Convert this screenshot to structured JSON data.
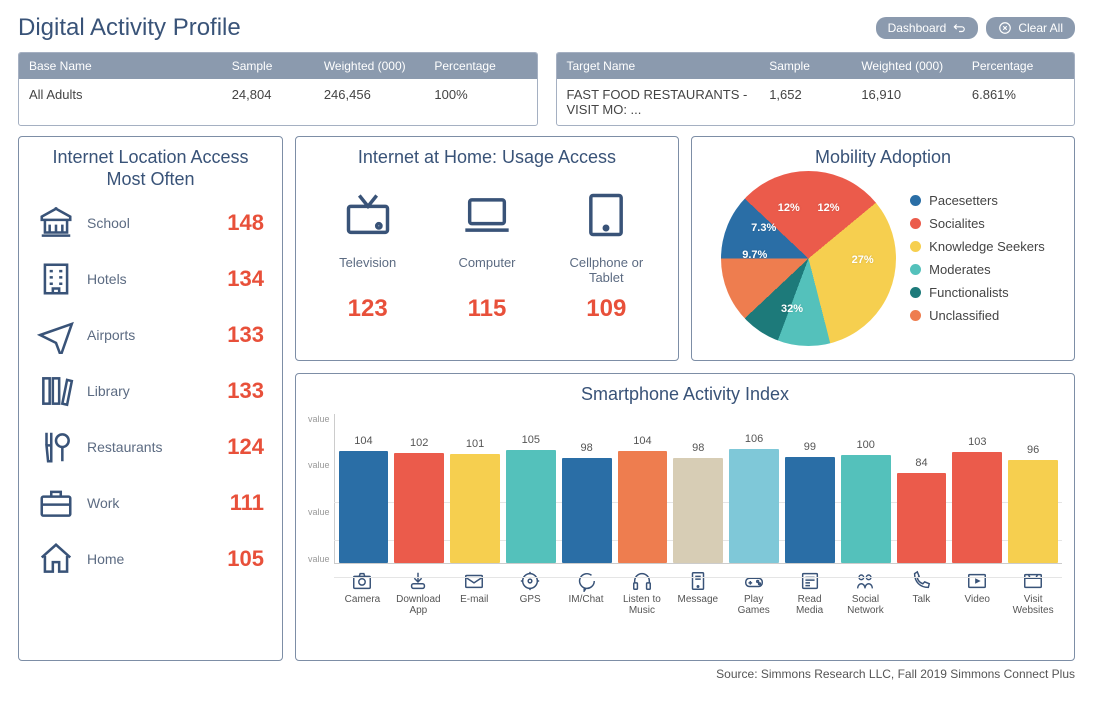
{
  "title": "Digital Activity Profile",
  "header_buttons": {
    "dashboard": "Dashboard",
    "clear_all": "Clear All"
  },
  "base_table": {
    "headers": {
      "c1": "Base Name",
      "c2": "Sample",
      "c3": "Weighted (000)",
      "c4": "Percentage"
    },
    "row": {
      "name": "All Adults",
      "sample": "24,804",
      "weighted": "246,456",
      "percentage": "100%"
    }
  },
  "target_table": {
    "headers": {
      "c1": "Target Name",
      "c2": "Sample",
      "c3": "Weighted (000)",
      "c4": "Percentage"
    },
    "row": {
      "name": "FAST FOOD RESTAURANTS - VISIT MO: ...",
      "sample": "1,652",
      "weighted": "16,910",
      "percentage": "6.861%"
    }
  },
  "location_panel": {
    "title": "Internet Location Access Most Often",
    "items": [
      {
        "label": "School",
        "value": "148",
        "icon": "school-icon"
      },
      {
        "label": "Hotels",
        "value": "134",
        "icon": "building-icon"
      },
      {
        "label": "Airports",
        "value": "133",
        "icon": "airplane-icon"
      },
      {
        "label": "Library",
        "value": "133",
        "icon": "books-icon"
      },
      {
        "label": "Restaurants",
        "value": "124",
        "icon": "utensils-icon"
      },
      {
        "label": "Work",
        "value": "111",
        "icon": "briefcase-icon"
      },
      {
        "label": "Home",
        "value": "105",
        "icon": "home-icon"
      }
    ]
  },
  "home_usage": {
    "title": "Internet at Home: Usage Access",
    "items": [
      {
        "label": "Television",
        "value": "123",
        "icon": "television-icon"
      },
      {
        "label": "Computer",
        "value": "115",
        "icon": "laptop-icon"
      },
      {
        "label": "Cellphone or Tablet",
        "value": "109",
        "icon": "tablet-icon"
      }
    ]
  },
  "mobility": {
    "title": "Mobility Adoption",
    "legend": [
      {
        "label": "Pacesetters",
        "color": "#2a6ea6"
      },
      {
        "label": "Socialites",
        "color": "#eb5b4b"
      },
      {
        "label": "Knowledge Seekers",
        "color": "#f6cf4f"
      },
      {
        "label": "Moderates",
        "color": "#54c1bb"
      },
      {
        "label": "Functionalists",
        "color": "#1d7a7a"
      },
      {
        "label": "Unclassified",
        "color": "#ee7d4f"
      }
    ]
  },
  "activity_index": {
    "title": "Smartphone Activity Index",
    "y_tick": "value",
    "bars": [
      {
        "label": "Camera",
        "value": 104,
        "color": "#2a6ea6",
        "icon": "camera-icon"
      },
      {
        "label": "Download App",
        "value": 102,
        "color": "#eb5b4b",
        "icon": "download-app-icon"
      },
      {
        "label": "E-mail",
        "value": 101,
        "color": "#f6cf4f",
        "icon": "email-icon"
      },
      {
        "label": "GPS",
        "value": 105,
        "color": "#54c1bb",
        "icon": "gps-icon"
      },
      {
        "label": "IM/Chat",
        "value": 98,
        "color": "#2a6ea6",
        "icon": "chat-icon"
      },
      {
        "label": "Listen to Music",
        "value": 104,
        "color": "#ee7d4f",
        "icon": "headphones-icon"
      },
      {
        "label": "Message",
        "value": 98,
        "color": "#d7cdb5",
        "icon": "message-icon"
      },
      {
        "label": "Play Games",
        "value": 106,
        "color": "#7fc8d8",
        "icon": "gamepad-icon"
      },
      {
        "label": "Read Media",
        "value": 99,
        "color": "#2a6ea6",
        "icon": "news-icon"
      },
      {
        "label": "Social Network",
        "value": 100,
        "color": "#54c1bb",
        "icon": "social-icon"
      },
      {
        "label": "Talk",
        "value": 84,
        "color": "#eb5b4b",
        "icon": "phone-icon"
      },
      {
        "label": "Video",
        "value": 103,
        "color": "#eb5b4b",
        "icon": "video-icon"
      },
      {
        "label": "Visit Websites",
        "value": 96,
        "color": "#f6cf4f",
        "icon": "browser-icon"
      }
    ]
  },
  "chart_data": [
    {
      "type": "pie",
      "title": "Mobility Adoption",
      "series": [
        {
          "name": "Pacesetters",
          "value": 12,
          "color": "#2a6ea6"
        },
        {
          "name": "Socialites",
          "value": 27,
          "color": "#eb5b4b"
        },
        {
          "name": "Knowledge Seekers",
          "value": 32,
          "color": "#f6cf4f"
        },
        {
          "name": "Moderates",
          "value": 9.7,
          "color": "#54c1bb"
        },
        {
          "name": "Functionalists",
          "value": 7.3,
          "color": "#1d7a7a"
        },
        {
          "name": "Unclassified",
          "value": 12,
          "color": "#ee7d4f"
        }
      ]
    },
    {
      "type": "bar",
      "title": "Smartphone Activity Index",
      "categories": [
        "Camera",
        "Download App",
        "E-mail",
        "GPS",
        "IM/Chat",
        "Listen to Music",
        "Message",
        "Play Games",
        "Read Media",
        "Social Network",
        "Talk",
        "Video",
        "Visit Websites"
      ],
      "values": [
        104,
        102,
        101,
        105,
        98,
        104,
        98,
        106,
        99,
        100,
        84,
        103,
        96
      ],
      "ylim": [
        0,
        140
      ],
      "ylabel": "value"
    }
  ],
  "source": "Source: Simmons Research LLC, Fall 2019 Simmons Connect Plus"
}
